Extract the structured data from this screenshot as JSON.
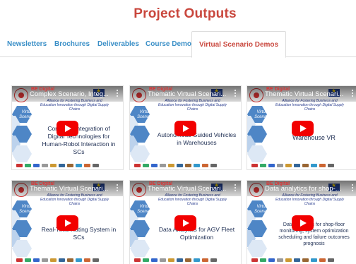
{
  "page": {
    "title": "Project Outputs"
  },
  "tabs": [
    {
      "label": "Newsletters",
      "active": false
    },
    {
      "label": "Brochures",
      "active": false
    },
    {
      "label": "Deliverables",
      "active": false
    },
    {
      "label": "Course Demos",
      "active": false
    },
    {
      "label": "Virtual Scenario Demos",
      "active": true
    }
  ],
  "thumb_common": {
    "brand": "BE Digital",
    "subtitle": "Alliance for Fostering Business and Education Innovation through Digital Supply Chains",
    "scenario_label": "Virtual Scenario"
  },
  "colors": {
    "accent_red": "#c9473d",
    "tab_blue": "#3a8fc7",
    "play_red": "#f20000",
    "hex_blue": "#4e86c6"
  },
  "videos": [
    {
      "title": "Complex Scenario, Integ...",
      "body": "Complete Integration of Digital Technologies for Human-Robot Interaction in SCs"
    },
    {
      "title": "Thematic Virtual Scenari...",
      "body": "Autonomous Guided Vehicles in Warehouses"
    },
    {
      "title": "Thematic Virtual Scenari...",
      "body": "Warehouse VR"
    },
    {
      "title": "Thematic Virtual Scenari...",
      "body": "Real-Time Rating System in SCs"
    },
    {
      "title": "Thematic Virtual Scenari...",
      "body": "Data Analytics for AGV Fleet Optimization"
    },
    {
      "title": "Data analytics for shop-...",
      "body": "Data analytics for shop-floor monitoring, system optimization scheduling and failure outcomes prognosis"
    }
  ]
}
